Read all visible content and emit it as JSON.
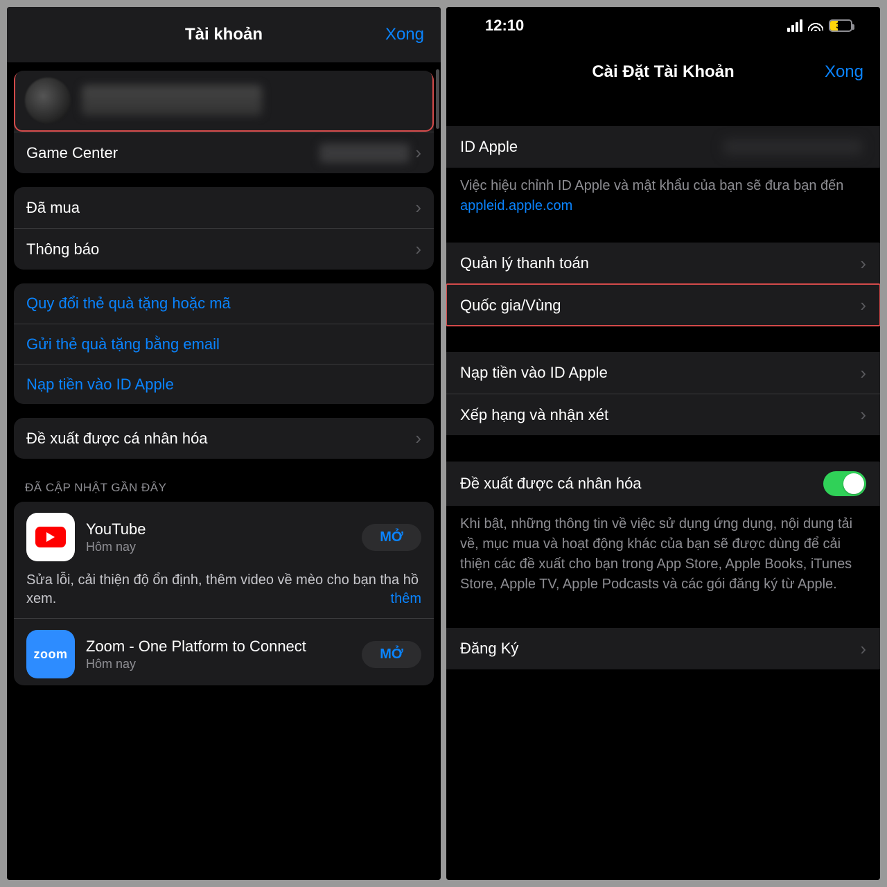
{
  "left": {
    "header": {
      "title": "Tài khoản",
      "done": "Xong"
    },
    "game_center": "Game Center",
    "purchased": "Đã mua",
    "notifications": "Thông báo",
    "links": {
      "redeem": "Quy đổi thẻ quà tặng hoặc mã",
      "send_gift": "Gửi thẻ quà tặng bằng email",
      "add_funds": "Nạp tiền vào ID Apple"
    },
    "personalized": "Đề xuất được cá nhân hóa",
    "section_recent": "ĐÃ CẬP NHẬT GẦN ĐÂY",
    "apps": {
      "youtube": {
        "name": "YouTube",
        "time": "Hôm nay",
        "open": "MỞ",
        "notes": "Sửa lỗi, cải thiện độ ổn định, thêm video về mèo cho bạn tha hồ xem.",
        "more": "thêm"
      },
      "zoom": {
        "name": "Zoom - One Platform to Connect",
        "time": "Hôm nay",
        "open": "MỞ",
        "logo": "zoom"
      }
    }
  },
  "right": {
    "status": {
      "time": "12:10",
      "battery": "38"
    },
    "header": {
      "title": "Cài Đặt Tài Khoản",
      "done": "Xong"
    },
    "apple_id_label": "ID Apple",
    "apple_id_note_pre": "Việc hiệu chỉnh ID Apple và mật khẩu của bạn sẽ đưa bạn đến ",
    "apple_id_link": "appleid.apple.com",
    "payment": "Quản lý thanh toán",
    "country": "Quốc gia/Vùng",
    "add_funds": "Nạp tiền vào ID Apple",
    "ratings": "Xếp hạng và nhận xét",
    "personalized": "Đề xuất được cá nhân hóa",
    "personalized_note": "Khi bật, những thông tin về việc sử dụng ứng dụng, nội dung tải về, mục mua và hoạt động khác của bạn sẽ được dùng để cải thiện các đề xuất cho bạn trong App Store, Apple Books, iTunes Store, Apple TV, Apple Podcasts và các gói đăng ký từ Apple.",
    "subscriptions": "Đăng Ký"
  }
}
